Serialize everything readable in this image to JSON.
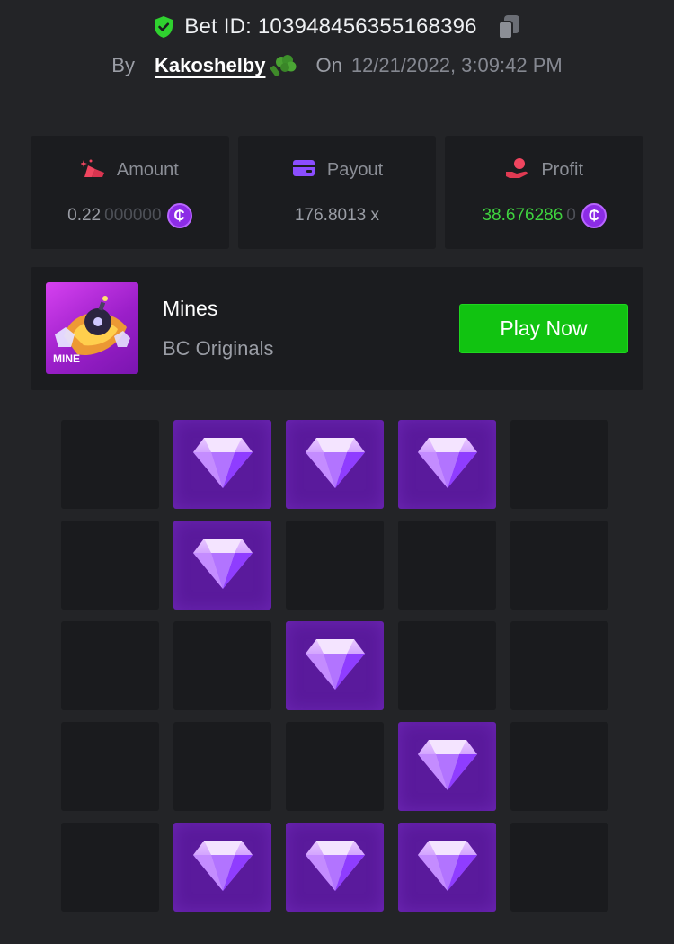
{
  "header": {
    "bet_id": "Bet ID: 103948456355168396",
    "by_label": "By",
    "username": "Kakoshelby",
    "on_label": "On",
    "datetime": "12/21/2022, 3:09:42 PM",
    "icons": [
      "shield-check-icon",
      "copy-icon",
      "broccoli-icon"
    ]
  },
  "stats": {
    "amount": {
      "label": "Amount",
      "value_main": "0.22",
      "value_dim": "000000",
      "icon": "amount-icon",
      "coin_icon": "coin-icon"
    },
    "payout": {
      "label": "Payout",
      "value": "176.8013 x",
      "icon": "wallet-card-icon"
    },
    "profit": {
      "label": "Profit",
      "value_main": "38.676286",
      "value_dim": "0",
      "icon": "profit-hand-icon",
      "coin_icon": "coin-icon"
    }
  },
  "coin_symbol": "₵",
  "game": {
    "title": "Mines",
    "subtitle": "BC Originals",
    "thumb_label": "MINE",
    "play_label": "Play Now"
  },
  "colors": {
    "background": "#232427",
    "card": "#1b1c1f",
    "play_button": "#11c311",
    "profit_green": "#3fd33f",
    "gem_tile": "#5a1a9c",
    "coin": "#8c2ce6"
  },
  "board": {
    "rows": 5,
    "cols": 5,
    "tiles": [
      [
        0,
        1,
        1,
        1,
        0
      ],
      [
        0,
        1,
        0,
        0,
        0
      ],
      [
        0,
        0,
        1,
        0,
        0
      ],
      [
        0,
        0,
        0,
        1,
        0
      ],
      [
        0,
        1,
        1,
        1,
        0
      ]
    ],
    "legend": {
      "1": "gem-icon",
      "0": "unrevealed"
    }
  }
}
